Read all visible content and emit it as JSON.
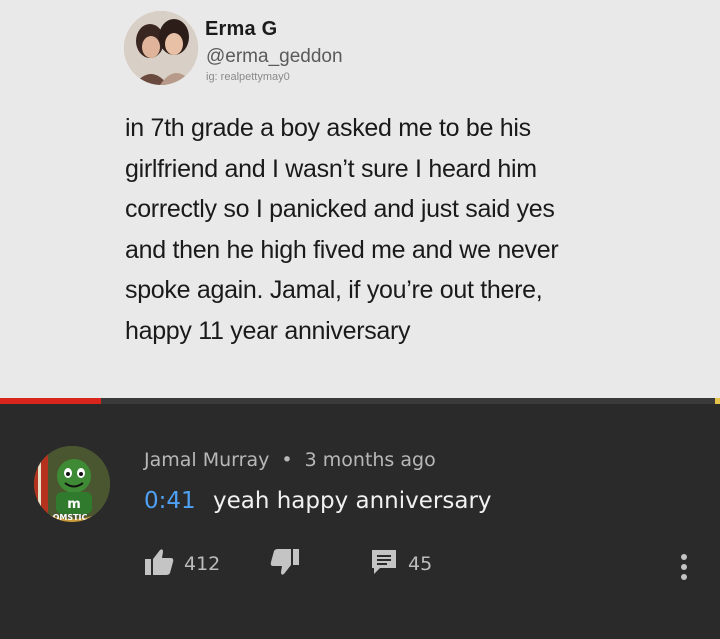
{
  "video": {
    "author_name": "Erma G",
    "author_handle": "@erma_geddon",
    "author_ig": "ig: realpettymay0",
    "text_lines": [
      "in 7th grade a boy asked me to be his",
      "girlfriend and I wasn’t sure I heard him",
      "correctly so I panicked and just said yes",
      "and then he high fived me and we never",
      "spoke again. Jamal, if you’re out there,",
      "happy 11 year anniversary"
    ],
    "progress_fraction": 0.14
  },
  "comment": {
    "author": "Jamal Murray",
    "separator": "•",
    "time_ago": "3 months ago",
    "timestamp": "0:41",
    "text": "yeah happy anniversary",
    "avatar_text": "OMSTIC",
    "likes": "412",
    "replies": "45"
  },
  "icons": {
    "like": "thumbs-up-icon",
    "dislike": "thumbs-down-icon",
    "reply": "comment-icon",
    "more": "more-vertical-icon"
  },
  "colors": {
    "background": "#2a2a2a",
    "progress": "#d9261c",
    "timestamp_link": "#4ea1f3"
  }
}
